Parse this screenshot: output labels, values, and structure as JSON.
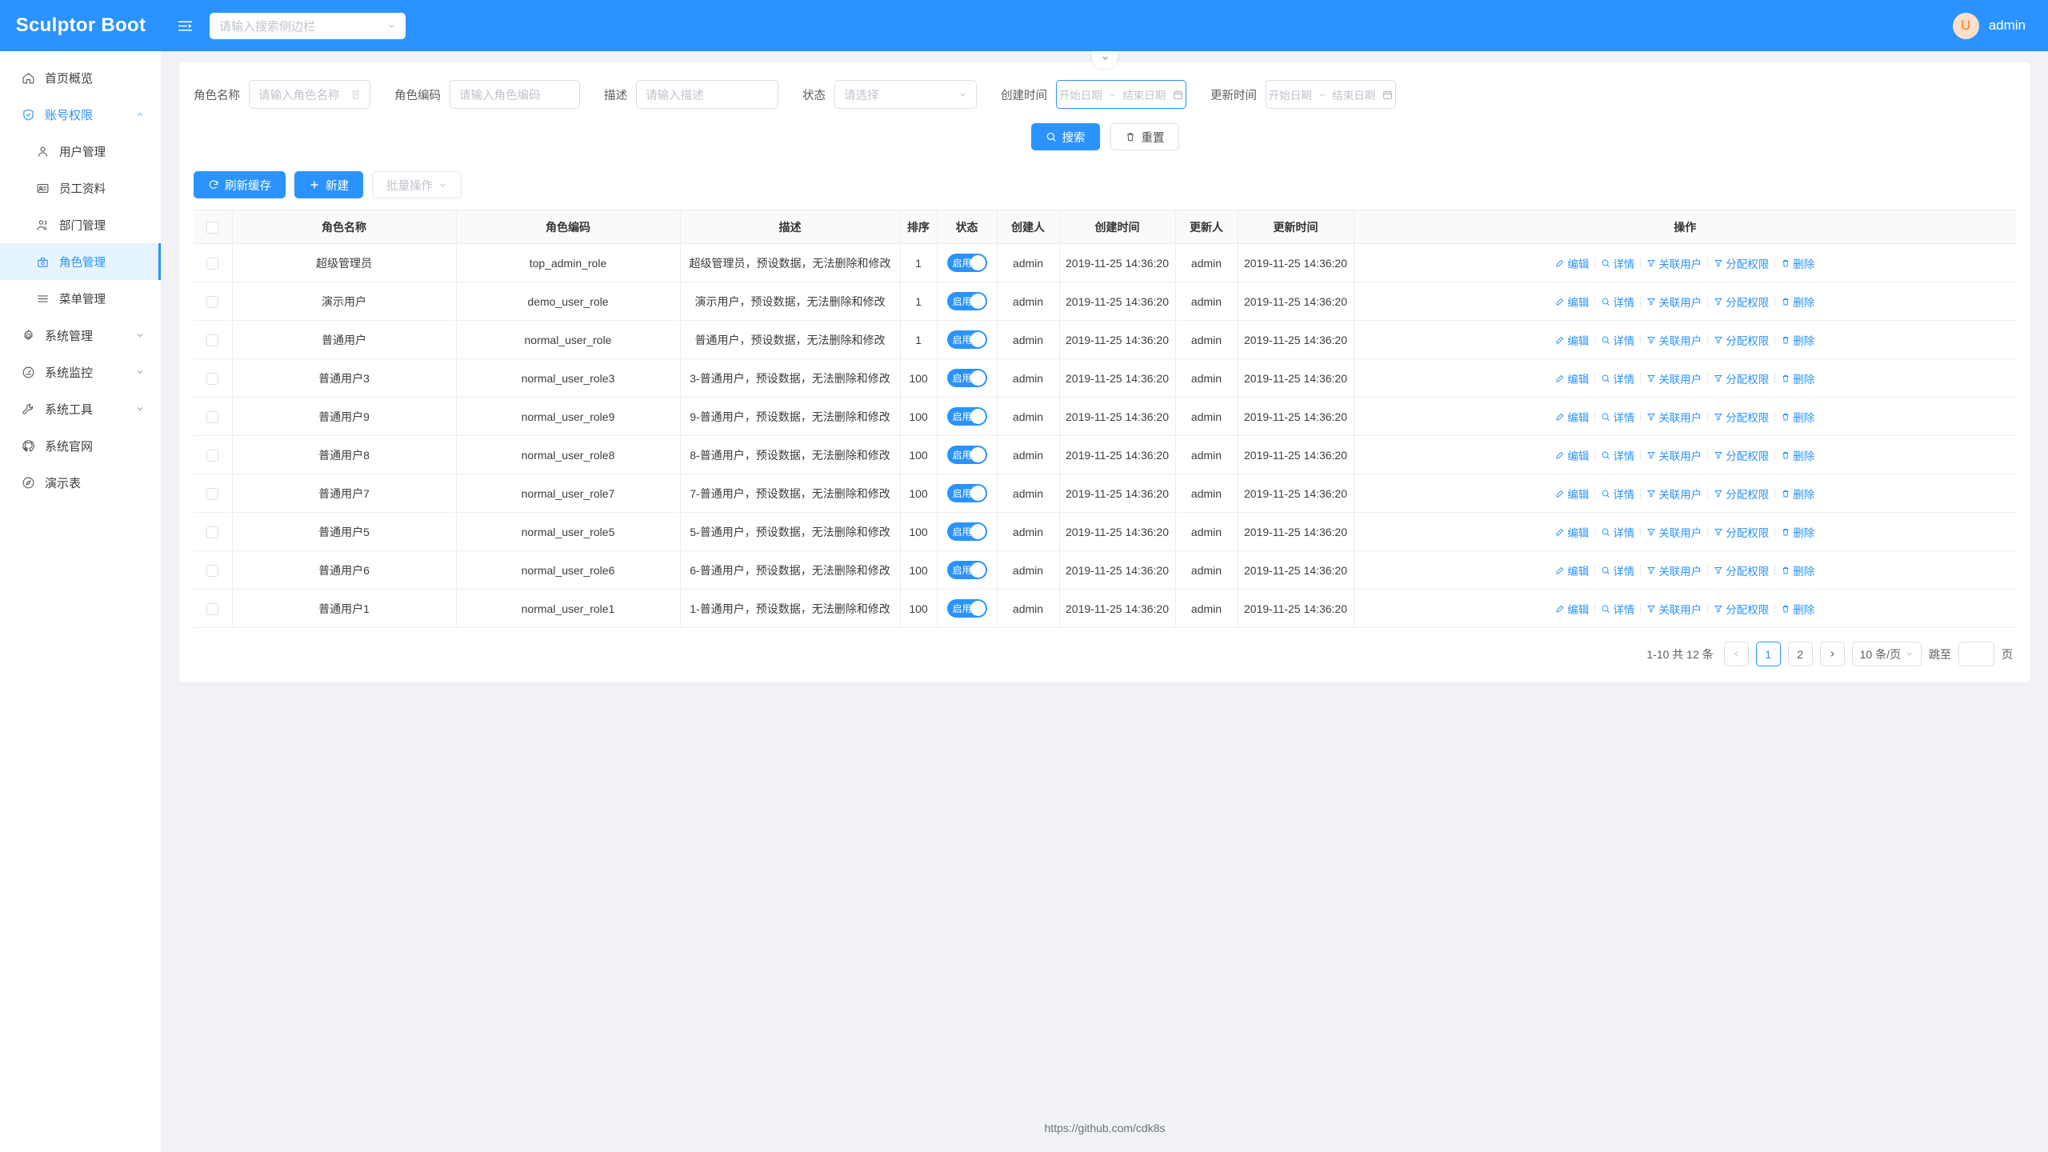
{
  "header": {
    "logo": "Sculptor Boot",
    "collapse_icon": "menu-fold-icon",
    "sidebar_search_placeholder": "请输入搜索侧边栏",
    "avatar_initial": "U",
    "username": "admin",
    "brand_color": "#2a93ff"
  },
  "sidebar": {
    "items": [
      {
        "label": "首页概览",
        "icon": "home-icon",
        "level": 0,
        "active": false,
        "expandable": false
      },
      {
        "label": "账号权限",
        "icon": "shield-check-icon",
        "level": 0,
        "active": false,
        "activeParent": true,
        "expandable": true,
        "expanded": true
      },
      {
        "label": "用户管理",
        "icon": "user-icon",
        "level": 1,
        "active": false,
        "expandable": false
      },
      {
        "label": "员工资料",
        "icon": "id-card-icon",
        "level": 1,
        "active": false,
        "expandable": false
      },
      {
        "label": "部门管理",
        "icon": "users-icon",
        "level": 1,
        "active": false,
        "expandable": false
      },
      {
        "label": "角色管理",
        "icon": "role-icon",
        "level": 1,
        "active": true,
        "expandable": false
      },
      {
        "label": "菜单管理",
        "icon": "list-icon",
        "level": 1,
        "active": false,
        "expandable": false
      },
      {
        "label": "系统管理",
        "icon": "gear-icon",
        "level": 0,
        "active": false,
        "expandable": true,
        "expanded": false
      },
      {
        "label": "系统监控",
        "icon": "gauge-icon",
        "level": 0,
        "active": false,
        "expandable": true,
        "expanded": false
      },
      {
        "label": "系统工具",
        "icon": "wrench-icon",
        "level": 0,
        "active": false,
        "expandable": true,
        "expanded": false
      },
      {
        "label": "系统官网",
        "icon": "github-icon",
        "level": 0,
        "active": false,
        "expandable": false
      },
      {
        "label": "演示表",
        "icon": "compass-icon",
        "level": 0,
        "active": false,
        "expandable": false
      }
    ]
  },
  "expander": {
    "icon": "chevron-down-icon"
  },
  "filters": {
    "role_name": {
      "label": "角色名称",
      "placeholder": "请输入角色名称",
      "value": "",
      "suffix_icon": "sort-icon"
    },
    "role_code": {
      "label": "角色编码",
      "placeholder": "请输入角色编码",
      "value": ""
    },
    "description": {
      "label": "描述",
      "placeholder": "请输入描述",
      "value": ""
    },
    "status": {
      "label": "状态",
      "placeholder": "请选择",
      "value": "",
      "suffix_icon": "chevron-down-icon"
    },
    "create_time": {
      "label": "创建时间",
      "start_placeholder": "开始日期",
      "separator": "~",
      "end_placeholder": "结束日期",
      "suffix_icon": "calendar-icon",
      "focused": true
    },
    "update_time": {
      "label": "更新时间",
      "start_placeholder": "开始日期",
      "separator": "~",
      "end_placeholder": "结束日期",
      "suffix_icon": "calendar-icon",
      "focused": false
    },
    "search_button": {
      "label": "搜索",
      "icon": "search-icon"
    },
    "reset_button": {
      "label": "重置",
      "icon": "trash-icon"
    }
  },
  "toolbar": {
    "refresh_cache": {
      "label": "刷新缓存",
      "icon": "refresh-icon"
    },
    "create": {
      "label": "新建",
      "icon": "plus-icon"
    },
    "batch": {
      "label": "批量操作",
      "icon": "chevron-down-icon",
      "disabled": true
    }
  },
  "table": {
    "columns": [
      "角色名称",
      "角色编码",
      "描述",
      "排序",
      "状态",
      "创建人",
      "创建时间",
      "更新人",
      "更新时间",
      "操作"
    ],
    "status_on_label": "启用",
    "actions": [
      {
        "label": "编辑",
        "icon": "pencil-icon"
      },
      {
        "label": "详情",
        "icon": "search-icon"
      },
      {
        "label": "关联用户",
        "icon": "filter-icon"
      },
      {
        "label": "分配权限",
        "icon": "filter-icon"
      },
      {
        "label": "删除",
        "icon": "trash-icon"
      }
    ],
    "rows": [
      {
        "name": "超级管理员",
        "code": "top_admin_role",
        "desc": "超级管理员，预设数据，无法删除和修改",
        "sort": "1",
        "status": "启用",
        "creator": "admin",
        "create_time": "2019-11-25 14:36:20",
        "updater": "admin",
        "update_time": "2019-11-25 14:36:20"
      },
      {
        "name": "演示用户",
        "code": "demo_user_role",
        "desc": "演示用户，预设数据，无法删除和修改",
        "sort": "1",
        "status": "启用",
        "creator": "admin",
        "create_time": "2019-11-25 14:36:20",
        "updater": "admin",
        "update_time": "2019-11-25 14:36:20"
      },
      {
        "name": "普通用户",
        "code": "normal_user_role",
        "desc": "普通用户，预设数据，无法删除和修改",
        "sort": "1",
        "status": "启用",
        "creator": "admin",
        "create_time": "2019-11-25 14:36:20",
        "updater": "admin",
        "update_time": "2019-11-25 14:36:20"
      },
      {
        "name": "普通用户3",
        "code": "normal_user_role3",
        "desc": "3-普通用户，预设数据，无法删除和修改",
        "sort": "100",
        "status": "启用",
        "creator": "admin",
        "create_time": "2019-11-25 14:36:20",
        "updater": "admin",
        "update_time": "2019-11-25 14:36:20"
      },
      {
        "name": "普通用户9",
        "code": "normal_user_role9",
        "desc": "9-普通用户，预设数据，无法删除和修改",
        "sort": "100",
        "status": "启用",
        "creator": "admin",
        "create_time": "2019-11-25 14:36:20",
        "updater": "admin",
        "update_time": "2019-11-25 14:36:20"
      },
      {
        "name": "普通用户8",
        "code": "normal_user_role8",
        "desc": "8-普通用户，预设数据，无法删除和修改",
        "sort": "100",
        "status": "启用",
        "creator": "admin",
        "create_time": "2019-11-25 14:36:20",
        "updater": "admin",
        "update_time": "2019-11-25 14:36:20"
      },
      {
        "name": "普通用户7",
        "code": "normal_user_role7",
        "desc": "7-普通用户，预设数据，无法删除和修改",
        "sort": "100",
        "status": "启用",
        "creator": "admin",
        "create_time": "2019-11-25 14:36:20",
        "updater": "admin",
        "update_time": "2019-11-25 14:36:20"
      },
      {
        "name": "普通用户5",
        "code": "normal_user_role5",
        "desc": "5-普通用户，预设数据，无法删除和修改",
        "sort": "100",
        "status": "启用",
        "creator": "admin",
        "create_time": "2019-11-25 14:36:20",
        "updater": "admin",
        "update_time": "2019-11-25 14:36:20"
      },
      {
        "name": "普通用户6",
        "code": "normal_user_role6",
        "desc": "6-普通用户，预设数据，无法删除和修改",
        "sort": "100",
        "status": "启用",
        "creator": "admin",
        "create_time": "2019-11-25 14:36:20",
        "updater": "admin",
        "update_time": "2019-11-25 14:36:20"
      },
      {
        "name": "普通用户1",
        "code": "normal_user_role1",
        "desc": "1-普通用户，预设数据，无法删除和修改",
        "sort": "100",
        "status": "启用",
        "creator": "admin",
        "create_time": "2019-11-25 14:36:20",
        "updater": "admin",
        "update_time": "2019-11-25 14:36:20"
      }
    ]
  },
  "pagination": {
    "total_text": "1-10 共 12 条",
    "prev_icon": "chevron-left-icon",
    "next_icon": "chevron-right-icon",
    "pages": [
      "1",
      "2"
    ],
    "current_page": "1",
    "page_size_label": "10 条/页",
    "jump_label": "跳至",
    "jump_value": "",
    "jump_unit": "页"
  },
  "footer": {
    "link": "https://github.com/cdk8s"
  }
}
